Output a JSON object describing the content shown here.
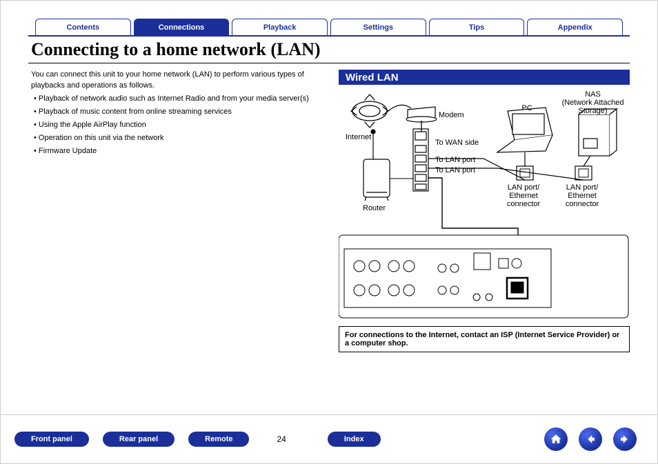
{
  "tabs": [
    {
      "label": "Contents",
      "active": false
    },
    {
      "label": "Connections",
      "active": true
    },
    {
      "label": "Playback",
      "active": false
    },
    {
      "label": "Settings",
      "active": false
    },
    {
      "label": "Tips",
      "active": false
    },
    {
      "label": "Appendix",
      "active": false
    }
  ],
  "title": "Connecting to a home network (LAN)",
  "intro": "You can connect this unit to your home network (LAN) to perform various types of playbacks and operations as follows.",
  "bullets": [
    "Playback of network audio such as Internet Radio and from your media server(s)",
    "Playback of music content from online streaming services",
    "Using the Apple AirPlay function",
    "Operation on this unit via the network",
    "Firmware Update"
  ],
  "section_header": "Wired LAN",
  "diagram": {
    "internet": "Internet",
    "modem": "Modem",
    "router": "Router",
    "wan": "To WAN side",
    "lan1": "To LAN port",
    "lan2": "To LAN port",
    "pc": "PC",
    "nas": "NAS\n(Network Attached Storage)",
    "pcport": "LAN port/\nEthernet connector",
    "nasport": "LAN port/\nEthernet connector"
  },
  "note": "For connections to the Internet, contact an ISP (Internet Service Provider) or a computer shop.",
  "bottom": {
    "front": "Front panel",
    "rear": "Rear panel",
    "remote": "Remote",
    "index": "Index",
    "page": "24"
  },
  "icons": {
    "home": "home-icon",
    "prev": "arrow-left-icon",
    "next": "arrow-right-icon"
  }
}
